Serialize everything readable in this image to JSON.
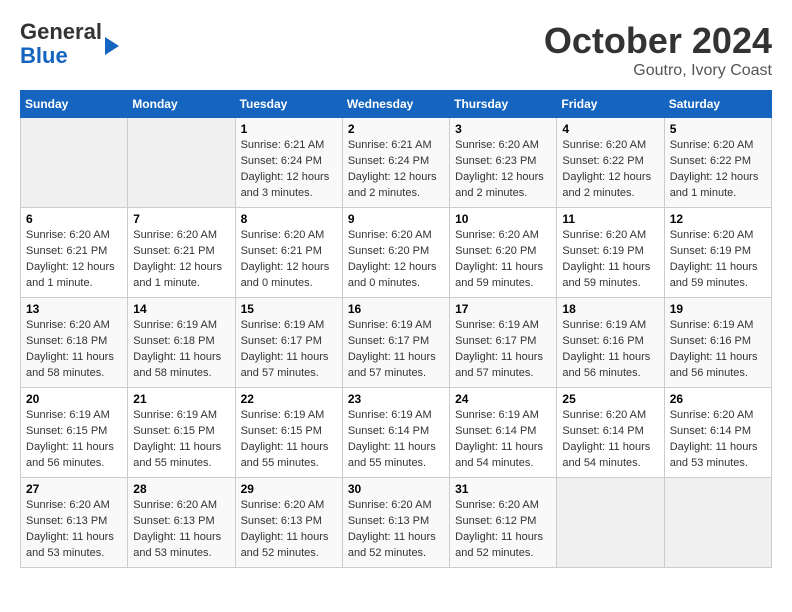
{
  "header": {
    "logo_line1": "General",
    "logo_line2": "Blue",
    "month": "October 2024",
    "location": "Goutro, Ivory Coast"
  },
  "days_of_week": [
    "Sunday",
    "Monday",
    "Tuesday",
    "Wednesday",
    "Thursday",
    "Friday",
    "Saturday"
  ],
  "weeks": [
    [
      {
        "day": "",
        "info": ""
      },
      {
        "day": "",
        "info": ""
      },
      {
        "day": "1",
        "info": "Sunrise: 6:21 AM\nSunset: 6:24 PM\nDaylight: 12 hours and 3 minutes."
      },
      {
        "day": "2",
        "info": "Sunrise: 6:21 AM\nSunset: 6:24 PM\nDaylight: 12 hours and 2 minutes."
      },
      {
        "day": "3",
        "info": "Sunrise: 6:20 AM\nSunset: 6:23 PM\nDaylight: 12 hours and 2 minutes."
      },
      {
        "day": "4",
        "info": "Sunrise: 6:20 AM\nSunset: 6:22 PM\nDaylight: 12 hours and 2 minutes."
      },
      {
        "day": "5",
        "info": "Sunrise: 6:20 AM\nSunset: 6:22 PM\nDaylight: 12 hours and 1 minute."
      }
    ],
    [
      {
        "day": "6",
        "info": "Sunrise: 6:20 AM\nSunset: 6:21 PM\nDaylight: 12 hours and 1 minute."
      },
      {
        "day": "7",
        "info": "Sunrise: 6:20 AM\nSunset: 6:21 PM\nDaylight: 12 hours and 1 minute."
      },
      {
        "day": "8",
        "info": "Sunrise: 6:20 AM\nSunset: 6:21 PM\nDaylight: 12 hours and 0 minutes."
      },
      {
        "day": "9",
        "info": "Sunrise: 6:20 AM\nSunset: 6:20 PM\nDaylight: 12 hours and 0 minutes."
      },
      {
        "day": "10",
        "info": "Sunrise: 6:20 AM\nSunset: 6:20 PM\nDaylight: 11 hours and 59 minutes."
      },
      {
        "day": "11",
        "info": "Sunrise: 6:20 AM\nSunset: 6:19 PM\nDaylight: 11 hours and 59 minutes."
      },
      {
        "day": "12",
        "info": "Sunrise: 6:20 AM\nSunset: 6:19 PM\nDaylight: 11 hours and 59 minutes."
      }
    ],
    [
      {
        "day": "13",
        "info": "Sunrise: 6:20 AM\nSunset: 6:18 PM\nDaylight: 11 hours and 58 minutes."
      },
      {
        "day": "14",
        "info": "Sunrise: 6:19 AM\nSunset: 6:18 PM\nDaylight: 11 hours and 58 minutes."
      },
      {
        "day": "15",
        "info": "Sunrise: 6:19 AM\nSunset: 6:17 PM\nDaylight: 11 hours and 57 minutes."
      },
      {
        "day": "16",
        "info": "Sunrise: 6:19 AM\nSunset: 6:17 PM\nDaylight: 11 hours and 57 minutes."
      },
      {
        "day": "17",
        "info": "Sunrise: 6:19 AM\nSunset: 6:17 PM\nDaylight: 11 hours and 57 minutes."
      },
      {
        "day": "18",
        "info": "Sunrise: 6:19 AM\nSunset: 6:16 PM\nDaylight: 11 hours and 56 minutes."
      },
      {
        "day": "19",
        "info": "Sunrise: 6:19 AM\nSunset: 6:16 PM\nDaylight: 11 hours and 56 minutes."
      }
    ],
    [
      {
        "day": "20",
        "info": "Sunrise: 6:19 AM\nSunset: 6:15 PM\nDaylight: 11 hours and 56 minutes."
      },
      {
        "day": "21",
        "info": "Sunrise: 6:19 AM\nSunset: 6:15 PM\nDaylight: 11 hours and 55 minutes."
      },
      {
        "day": "22",
        "info": "Sunrise: 6:19 AM\nSunset: 6:15 PM\nDaylight: 11 hours and 55 minutes."
      },
      {
        "day": "23",
        "info": "Sunrise: 6:19 AM\nSunset: 6:14 PM\nDaylight: 11 hours and 55 minutes."
      },
      {
        "day": "24",
        "info": "Sunrise: 6:19 AM\nSunset: 6:14 PM\nDaylight: 11 hours and 54 minutes."
      },
      {
        "day": "25",
        "info": "Sunrise: 6:20 AM\nSunset: 6:14 PM\nDaylight: 11 hours and 54 minutes."
      },
      {
        "day": "26",
        "info": "Sunrise: 6:20 AM\nSunset: 6:14 PM\nDaylight: 11 hours and 53 minutes."
      }
    ],
    [
      {
        "day": "27",
        "info": "Sunrise: 6:20 AM\nSunset: 6:13 PM\nDaylight: 11 hours and 53 minutes."
      },
      {
        "day": "28",
        "info": "Sunrise: 6:20 AM\nSunset: 6:13 PM\nDaylight: 11 hours and 53 minutes."
      },
      {
        "day": "29",
        "info": "Sunrise: 6:20 AM\nSunset: 6:13 PM\nDaylight: 11 hours and 52 minutes."
      },
      {
        "day": "30",
        "info": "Sunrise: 6:20 AM\nSunset: 6:13 PM\nDaylight: 11 hours and 52 minutes."
      },
      {
        "day": "31",
        "info": "Sunrise: 6:20 AM\nSunset: 6:12 PM\nDaylight: 11 hours and 52 minutes."
      },
      {
        "day": "",
        "info": ""
      },
      {
        "day": "",
        "info": ""
      }
    ]
  ]
}
